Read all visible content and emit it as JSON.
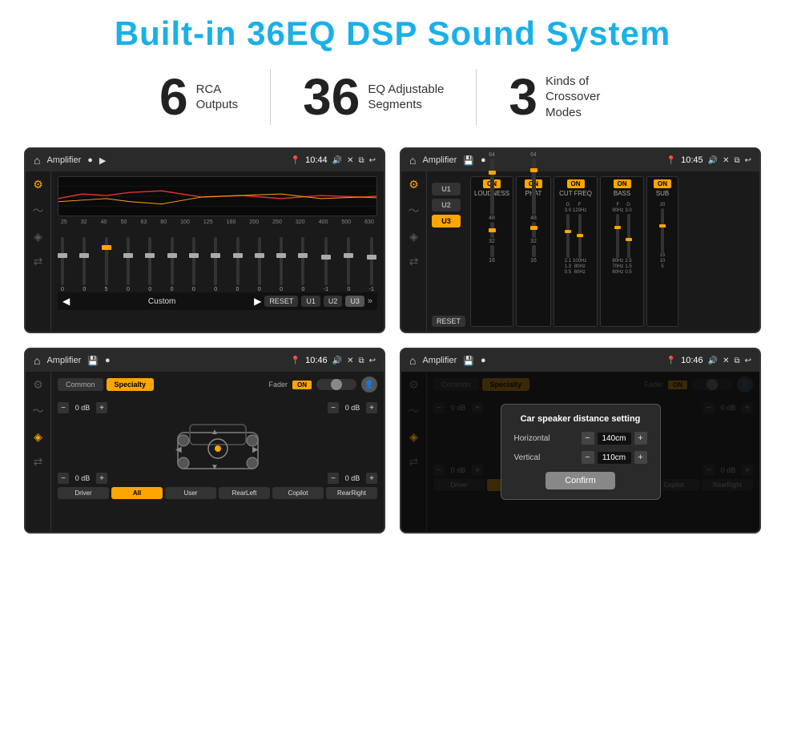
{
  "header": {
    "title": "Built-in 36EQ DSP Sound System"
  },
  "stats": [
    {
      "number": "6",
      "label": "RCA\nOutputs"
    },
    {
      "number": "36",
      "label": "EQ Adjustable\nSegments"
    },
    {
      "number": "3",
      "label": "Kinds of\nCrossover Modes"
    }
  ],
  "screens": [
    {
      "id": "screen1",
      "topbar": {
        "title": "Amplifier",
        "time": "10:44"
      },
      "type": "eq"
    },
    {
      "id": "screen2",
      "topbar": {
        "title": "Amplifier",
        "time": "10:45"
      },
      "type": "crossover"
    },
    {
      "id": "screen3",
      "topbar": {
        "title": "Amplifier",
        "time": "10:46"
      },
      "type": "speaker"
    },
    {
      "id": "screen4",
      "topbar": {
        "title": "Amplifier",
        "time": "10:46"
      },
      "type": "speaker-dialog"
    }
  ],
  "eq": {
    "frequencies": [
      "25",
      "32",
      "40",
      "50",
      "63",
      "80",
      "100",
      "125",
      "160",
      "200",
      "250",
      "320",
      "400",
      "500",
      "630"
    ],
    "sliderPositions": [
      50,
      45,
      42,
      48,
      38,
      35,
      50,
      52,
      48,
      50,
      47,
      45,
      49,
      50,
      48
    ],
    "values": [
      "0",
      "0",
      "5",
      "0",
      "0",
      "0",
      "0",
      "0",
      "0",
      "0",
      "0",
      "0",
      "-1",
      "0",
      "-1"
    ],
    "presetLabel": "Custom",
    "buttons": [
      "RESET",
      "U1",
      "U2",
      "U3"
    ]
  },
  "crossover": {
    "presets": [
      "U1",
      "U2",
      "U3"
    ],
    "activePreset": "U3",
    "channels": [
      {
        "name": "LOUDNESS",
        "on": true
      },
      {
        "name": "PHAT",
        "on": true
      },
      {
        "name": "CUT FREQ",
        "on": true
      },
      {
        "name": "BASS",
        "on": true
      },
      {
        "name": "SUB",
        "on": true
      }
    ],
    "resetLabel": "RESET"
  },
  "speaker": {
    "tabs": [
      "Common",
      "Specialty"
    ],
    "activeTab": "Specialty",
    "faderLabel": "Fader",
    "faderOn": "ON",
    "channels": [
      {
        "label": "",
        "value": "0 dB"
      },
      {
        "label": "",
        "value": "0 dB"
      },
      {
        "label": "",
        "value": "0 dB"
      },
      {
        "label": "",
        "value": "0 dB"
      }
    ],
    "bottomBtns": [
      "Driver",
      "RearLeft",
      "All",
      "User",
      "Copilot",
      "RearRight"
    ]
  },
  "dialog": {
    "title": "Car speaker distance setting",
    "rows": [
      {
        "label": "Horizontal",
        "value": "140cm"
      },
      {
        "label": "Vertical",
        "value": "110cm"
      }
    ],
    "confirmLabel": "Confirm"
  }
}
